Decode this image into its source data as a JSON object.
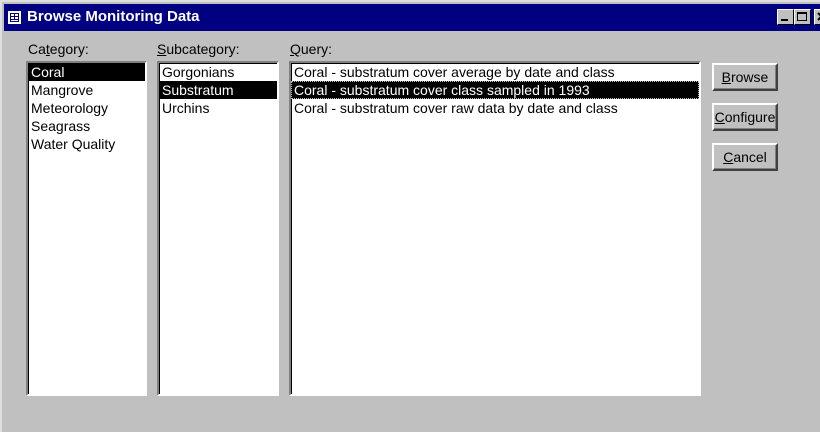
{
  "window": {
    "title": "Browse Monitoring Data",
    "icon": "form-icon"
  },
  "labels": {
    "category": {
      "pre": "Ca",
      "key": "t",
      "post": "egory:"
    },
    "subcategory": {
      "pre": "",
      "key": "S",
      "post": "ubcategory:"
    },
    "query": {
      "pre": "",
      "key": "Q",
      "post": "uery:"
    }
  },
  "categories": [
    "Coral",
    "Mangrove",
    "Meteorology",
    "Seagrass",
    "Water Quality"
  ],
  "selected_category": "Coral",
  "subcategories": [
    "Gorgonians",
    "Substratum",
    "Urchins"
  ],
  "selected_subcategory": "Substratum",
  "queries": [
    "Coral - substratum cover average by date and class",
    "Coral - substratum cover class sampled in 1993",
    "Coral - substratum cover raw data by date and class"
  ],
  "selected_query": "Coral - substratum cover class sampled in 1993",
  "buttons": {
    "browse": {
      "key": "B",
      "rest": "rowse"
    },
    "configure": {
      "key": "C",
      "rest": "onfigure"
    },
    "cancel": {
      "key": "C",
      "rest": "ancel"
    }
  },
  "colors": {
    "titlebar": "#000080",
    "face": "#c0c0c0",
    "selection": "#000000"
  }
}
